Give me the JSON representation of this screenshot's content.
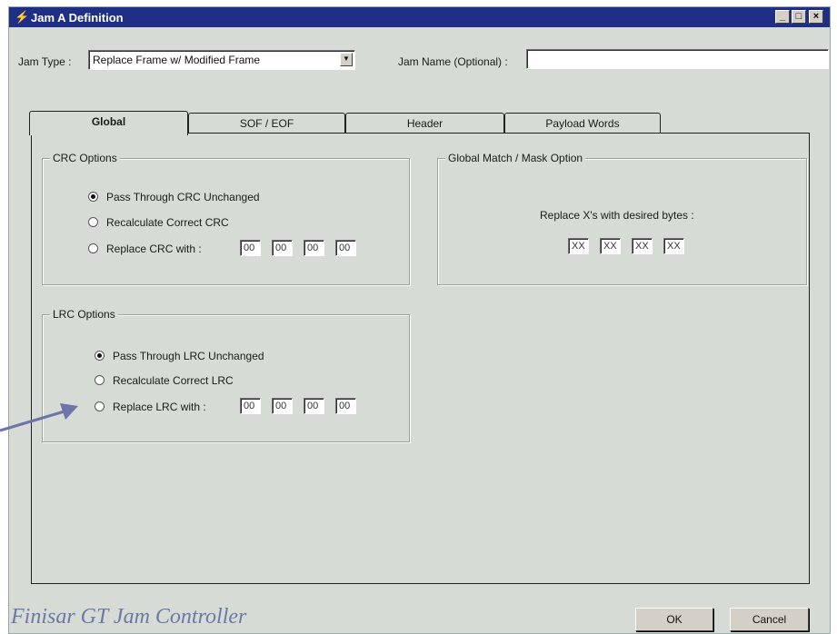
{
  "window": {
    "title": "Jam A Definition",
    "controls": {
      "minimize": "_",
      "maximize": "□",
      "close": "×"
    }
  },
  "jam_type": {
    "label": "Jam Type :",
    "value": "Replace Frame w/ Modified Frame"
  },
  "jam_name": {
    "label": "Jam Name (Optional) :",
    "value": ""
  },
  "tabs": [
    {
      "label": "Global",
      "active": true
    },
    {
      "label": "SOF / EOF",
      "active": false
    },
    {
      "label": "Header",
      "active": false
    },
    {
      "label": "Payload Words",
      "active": false
    }
  ],
  "crc_options": {
    "title": "CRC Options",
    "pass_through": "Pass Through CRC Unchanged",
    "recalculate": "Recalculate Correct CRC",
    "replace": "Replace CRC with :",
    "selected": "pass_through",
    "bytes": [
      "00",
      "00",
      "00",
      "00"
    ]
  },
  "lrc_options": {
    "title": "LRC Options",
    "pass_through": "Pass Through LRC Unchanged",
    "recalculate": "Recalculate Correct LRC",
    "replace": "Replace LRC with :",
    "selected": "pass_through",
    "bytes": [
      "00",
      "00",
      "00",
      "00"
    ]
  },
  "global_match": {
    "title": "Global Match / Mask Option",
    "description": "Replace X's  with desired bytes :",
    "bytes": [
      "XX",
      "XX",
      "XX",
      "XX"
    ]
  },
  "buttons": {
    "ok": "OK",
    "cancel": "Cancel"
  },
  "brand_text": "Finisar GT Jam Controller",
  "colors": {
    "titlebar": "#1f2f86",
    "dialog_bg": "#d6dcd5",
    "brand": "#6c78a5",
    "arrow": "#6c74a8"
  }
}
